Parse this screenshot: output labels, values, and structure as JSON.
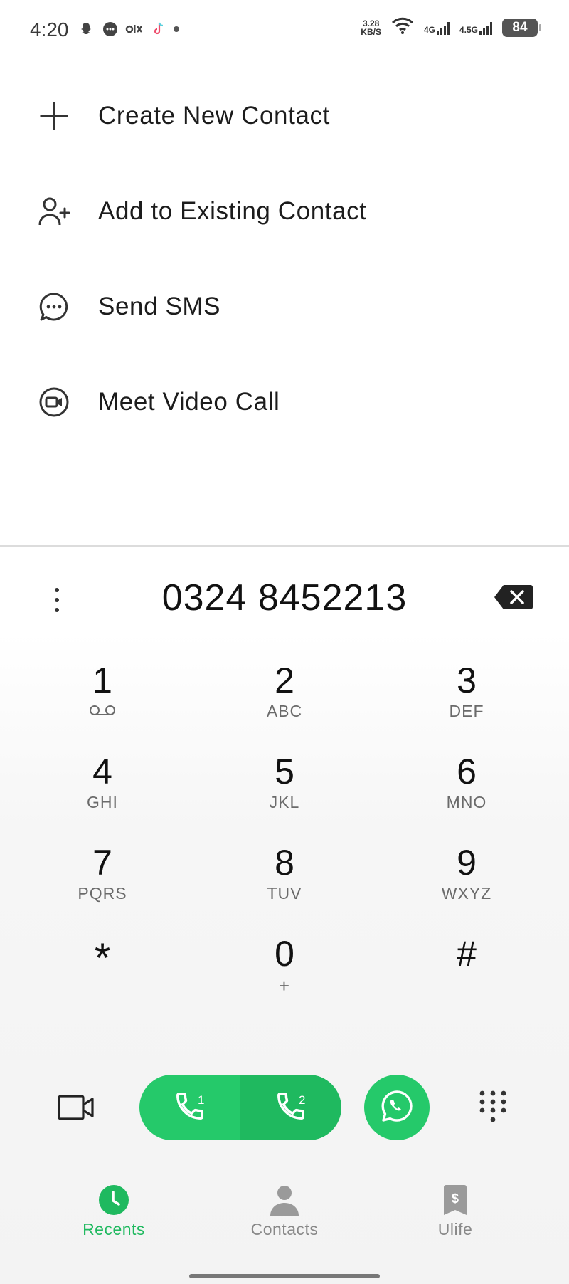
{
  "status_bar": {
    "time": "4:20",
    "net_speed_value": "3.28",
    "net_speed_unit": "KB/S",
    "sim1_network": "4G",
    "sim2_network": "4.5G",
    "battery": "84"
  },
  "menu": {
    "items": [
      {
        "label": "Create New Contact",
        "icon": "plus-icon"
      },
      {
        "label": "Add to Existing Contact",
        "icon": "add-person-icon"
      },
      {
        "label": "Send SMS",
        "icon": "sms-icon"
      },
      {
        "label": "Meet Video Call",
        "icon": "meet-icon"
      }
    ]
  },
  "dialer": {
    "number": "0324 8452213",
    "keys": [
      {
        "digit": "1",
        "letters": ""
      },
      {
        "digit": "2",
        "letters": "ABC"
      },
      {
        "digit": "3",
        "letters": "DEF"
      },
      {
        "digit": "4",
        "letters": "GHI"
      },
      {
        "digit": "5",
        "letters": "JKL"
      },
      {
        "digit": "6",
        "letters": "MNO"
      },
      {
        "digit": "7",
        "letters": "PQRS"
      },
      {
        "digit": "8",
        "letters": "TUV"
      },
      {
        "digit": "9",
        "letters": "WXYZ"
      },
      {
        "digit": "*",
        "letters": ""
      },
      {
        "digit": "0",
        "letters": "+"
      },
      {
        "digit": "#",
        "letters": ""
      }
    ],
    "sim1_label": "1",
    "sim2_label": "2"
  },
  "nav": {
    "recents": "Recents",
    "contacts": "Contacts",
    "ulife": "Ulife"
  },
  "colors": {
    "accent": "#25c96a",
    "accent_dark": "#1fb95f"
  }
}
